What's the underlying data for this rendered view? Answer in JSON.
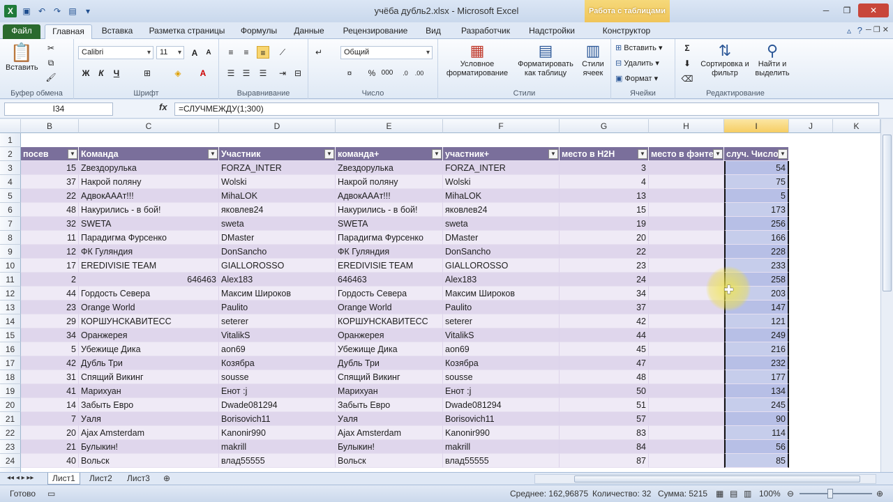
{
  "window": {
    "title": "учёба дубль2.xlsx  -  Microsoft Excel",
    "context_tab": "Работа с таблицами"
  },
  "tabs": [
    "Файл",
    "Главная",
    "Вставка",
    "Разметка страницы",
    "Формулы",
    "Данные",
    "Рецензирование",
    "Вид",
    "Разработчик",
    "Надстройки",
    "Конструктор"
  ],
  "ribbon": {
    "clipboard": {
      "paste": "Вставить",
      "label": "Буфер обмена"
    },
    "font": {
      "name": "Calibri",
      "size": "11",
      "label": "Шрифт",
      "bold": "Ж",
      "italic": "К",
      "underline": "Ч"
    },
    "alignment": {
      "label": "Выравнивание"
    },
    "number": {
      "format": "Общий",
      "label": "Число"
    },
    "styles": {
      "conditional": "Условное форматирование",
      "format_table": "Форматировать как таблицу",
      "cell_styles": "Стили ячеек",
      "label": "Стили"
    },
    "cells": {
      "insert": "Вставить",
      "delete": "Удалить",
      "format": "Формат",
      "label": "Ячейки"
    },
    "editing": {
      "sort": "Сортировка и фильтр",
      "find": "Найти и выделить",
      "label": "Редактирование"
    }
  },
  "formula_bar": {
    "name_box": "I34",
    "fx": "fx",
    "formula": "=СЛУЧМЕЖДУ(1;300)"
  },
  "columns": [
    "B",
    "C",
    "D",
    "E",
    "F",
    "G",
    "H",
    "I",
    "J",
    "K"
  ],
  "table_headers": [
    "посев",
    "Команда",
    "Участник",
    "команда+",
    "участник+",
    "место в H2H",
    "место в фэнте",
    "случ. Число"
  ],
  "rows": [
    {
      "r": "3",
      "b": "15",
      "c": "Zвездорулька",
      "d": "FORZA_INTER",
      "e": "Zвездорулька",
      "f": "FORZA_INTER",
      "g": "3",
      "i": "54"
    },
    {
      "r": "4",
      "b": "37",
      "c": "Накрой поляну",
      "d": "Wolski",
      "e": "Накрой поляну",
      "f": "Wolski",
      "g": "4",
      "i": "75"
    },
    {
      "r": "5",
      "b": "22",
      "c": "АдвокAAAт!!!",
      "d": "MihaLOK",
      "e": "АдвокAAAт!!!",
      "f": "MihaLOK",
      "g": "13",
      "i": "5"
    },
    {
      "r": "6",
      "b": "48",
      "c": "Накурились - в бой!",
      "d": "яковлев24",
      "e": "Накурились - в бой!",
      "f": "яковлев24",
      "g": "15",
      "i": "173"
    },
    {
      "r": "7",
      "b": "32",
      "c": "SWETA",
      "d": "sweta",
      "e": "SWETA",
      "f": "sweta",
      "g": "19",
      "i": "256"
    },
    {
      "r": "8",
      "b": "11",
      "c": "Парадигма Фурсенко",
      "d": "DMaster",
      "e": "Парадигма Фурсенко",
      "f": "DMaster",
      "g": "20",
      "i": "166"
    },
    {
      "r": "9",
      "b": "12",
      "c": "ФК Гуляндия",
      "d": "DonSancho",
      "e": "ФК Гуляндия",
      "f": "DonSancho",
      "g": "22",
      "i": "228"
    },
    {
      "r": "10",
      "b": "17",
      "c": "EREDIVISIE TEAM",
      "d": "GIALLOROSSO",
      "e": "EREDIVISIE TEAM",
      "f": "GIALLOROSSO",
      "g": "23",
      "i": "233"
    },
    {
      "r": "11",
      "b": "2",
      "c": "646463",
      "d": "Alex183",
      "e": "646463",
      "f": "Alex183",
      "g": "24",
      "i": "258",
      "cnum": true
    },
    {
      "r": "12",
      "b": "44",
      "c": "Гордость Севера",
      "d": "Максим Широков",
      "e": "Гордость Севера",
      "f": "Максим Широков",
      "g": "34",
      "i": "203"
    },
    {
      "r": "13",
      "b": "23",
      "c": "Orange World",
      "d": "Paulito",
      "e": "Orange World",
      "f": "Paulito",
      "g": "37",
      "i": "147"
    },
    {
      "r": "14",
      "b": "29",
      "c": "КОРШУНСКАВИТЕСС",
      "d": "seterer",
      "e": "КОРШУНСКАВИТЕСС",
      "f": "seterer",
      "g": "42",
      "i": "121"
    },
    {
      "r": "15",
      "b": "34",
      "c": "Оранжерея",
      "d": "VitalikS",
      "e": "Оранжерея",
      "f": "VitalikS",
      "g": "44",
      "i": "249"
    },
    {
      "r": "16",
      "b": "5",
      "c": "Убежище Дика",
      "d": "aon69",
      "e": "Убежище Дика",
      "f": "aon69",
      "g": "45",
      "i": "216"
    },
    {
      "r": "17",
      "b": "42",
      "c": "Дубль Три",
      "d": "Козябра",
      "e": "Дубль Три",
      "f": "Козябра",
      "g": "47",
      "i": "232"
    },
    {
      "r": "18",
      "b": "31",
      "c": "Спящий Викинг",
      "d": "sousse",
      "e": "Спящий Викинг",
      "f": "sousse",
      "g": "48",
      "i": "177"
    },
    {
      "r": "19",
      "b": "41",
      "c": "Марихуан",
      "d": "Енот :j",
      "e": "Марихуан",
      "f": "Енот :j",
      "g": "50",
      "i": "134"
    },
    {
      "r": "20",
      "b": "14",
      "c": "Забыть Евро",
      "d": "Dwade081294",
      "e": "Забыть Евро",
      "f": "Dwade081294",
      "g": "51",
      "i": "245"
    },
    {
      "r": "21",
      "b": "7",
      "c": "Уаля",
      "d": "Borisovich11",
      "e": "Уаля",
      "f": "Borisovich11",
      "g": "57",
      "i": "90"
    },
    {
      "r": "22",
      "b": "20",
      "c": "Ajax Amsterdam",
      "d": "Kanonir990",
      "e": "Ajax Amsterdam",
      "f": "Kanonir990",
      "g": "83",
      "i": "114"
    },
    {
      "r": "23",
      "b": "21",
      "c": "Булыкин!",
      "d": "makrill",
      "e": "Булыкин!",
      "f": "makrill",
      "g": "84",
      "i": "56"
    },
    {
      "r": "24",
      "b": "40",
      "c": "Вольск",
      "d": "влад55555",
      "e": "Вольск",
      "f": "влад55555",
      "g": "87",
      "i": "85"
    }
  ],
  "sheets": [
    "Лист1",
    "Лист2",
    "Лист3"
  ],
  "status": {
    "ready": "Готово",
    "avg": "Среднее: 162,96875",
    "count": "Количество: 32",
    "sum": "Сумма: 5215",
    "zoom": "100%"
  }
}
